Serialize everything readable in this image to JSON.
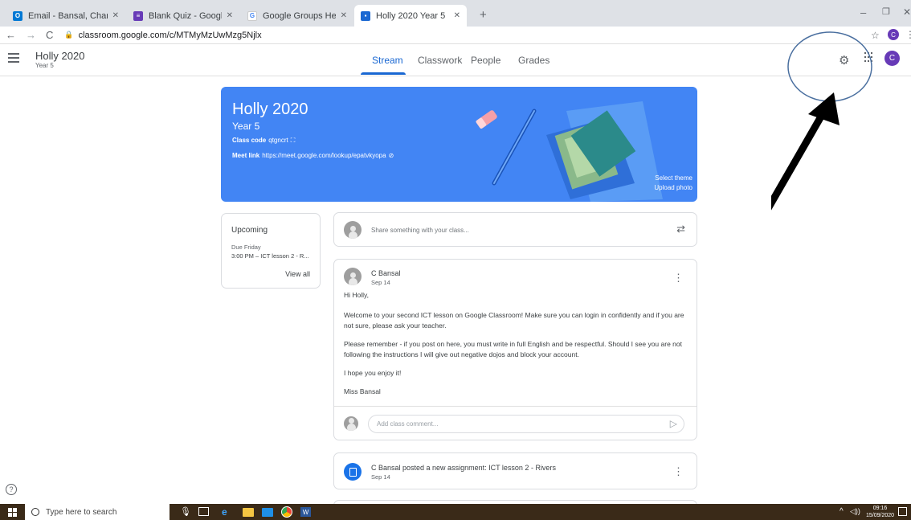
{
  "browser": {
    "tabs": [
      {
        "title": "Email - Bansal, Charanjit - Outlo",
        "icon_color": "#0078d4",
        "icon_letter": "O"
      },
      {
        "title": "Blank Quiz - Google Forms",
        "icon_color": "#673ab7",
        "icon_letter": "≡"
      },
      {
        "title": "Google Groups Help",
        "icon_color": "#ffffff",
        "icon_letter": "G"
      },
      {
        "title": "Holly 2020 Year 5",
        "icon_color": "#1e8e3e",
        "icon_letter": "▪"
      }
    ],
    "new_tab": "+",
    "url": "classroom.google.com/c/MTMyMzUwMzg5Njlx",
    "profile_initial": "C"
  },
  "app": {
    "class_name": "Holly 2020",
    "section": "Year 5",
    "tabs": [
      "Stream",
      "Classwork",
      "People",
      "Grades"
    ],
    "active_tab": "Stream",
    "user_initial": "C"
  },
  "banner": {
    "title": "Holly 2020",
    "subtitle": "Year 5",
    "class_code_label": "Class code",
    "class_code": "qtgncrt",
    "meet_label": "Meet link",
    "meet_link": "https://meet.google.com/lookup/epatvkyopa",
    "select_theme": "Select theme",
    "upload_photo": "Upload photo"
  },
  "upcoming": {
    "title": "Upcoming",
    "due": "Due Friday",
    "item": "3:00 PM – ICT lesson 2 - R...",
    "view_all": "View all"
  },
  "share": {
    "placeholder": "Share something with your class..."
  },
  "post": {
    "author": "C Bansal",
    "date": "Sep 14",
    "p1": "Hi Holly,",
    "p2": "Welcome to your second ICT lesson on Google Classroom! Make sure you can login in confidently and if you are not sure, please ask your teacher.",
    "p3": "Please remember - if you post on here, you must write in full English and be respectful. Should I see you are not following the instructions I will give out negative dojos and block your account.",
    "p4": "I hope you enjoy it!",
    "p5": "Miss Bansal",
    "comment_placeholder": "Add class comment..."
  },
  "assignment": {
    "title": "C Bansal posted a new assignment: ICT lesson 2 - Rivers",
    "date": "Sep 14"
  },
  "taskbar": {
    "search": "Type here to search",
    "time": "09:16",
    "date": "15/09/2020"
  },
  "colors": {
    "accent": "#1967d2",
    "banner": "#4285f4",
    "avatar": "#673ab7",
    "taskbar": "#3a2a18"
  }
}
